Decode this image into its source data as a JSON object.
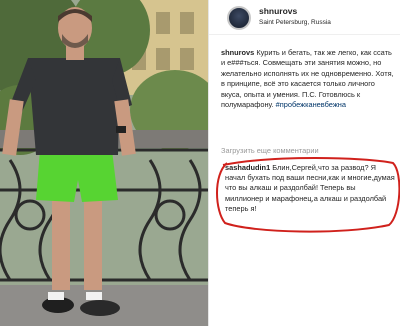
{
  "post": {
    "username": "shnurovs",
    "location": "Saint Petersburg, Russia",
    "caption_user": "shnurovs",
    "caption_text": " Курить и бегать, так же легко, как ссать и е###ться. Совмещать эти занятия можно, но желательно исполнять их не одновременно. Хотя, в принципе, всё это касается только личного вкуса, опыта и умения. П.С. Готовлюсь к полумарафону.",
    "hashtag": "#пробежканевбежна",
    "load_more": "Загрузить еще комментарии"
  },
  "comment": {
    "username": "sashadudin1",
    "text": " Блин,Сергей,что за развод? Я начал бухать под ваши песни,как и многие,думая что вы алкаш и раздолбай! Теперь вы миллионер и марафонец,а алкаш и раздолбай теперь я!"
  },
  "colors": {
    "text": "#262626",
    "muted": "#999999",
    "hashtag": "#003569",
    "highlight_circle": "#d0211c"
  }
}
